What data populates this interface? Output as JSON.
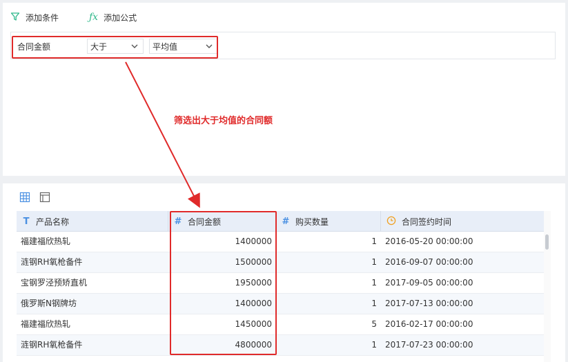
{
  "toolbar": {
    "add_condition": "添加条件",
    "add_formula": "添加公式"
  },
  "filter": {
    "field": "合同金额",
    "operator": "大于",
    "value": "平均值"
  },
  "annotation": "筛选出大于均值的合同额",
  "table": {
    "columns": [
      {
        "icon": "text-type-icon",
        "glyph": "T",
        "label": "产品名称"
      },
      {
        "icon": "number-type-icon",
        "glyph": "#",
        "label": "合同金额"
      },
      {
        "icon": "number-type-icon",
        "glyph": "#",
        "label": "购买数量"
      },
      {
        "icon": "time-type-icon",
        "glyph": "",
        "label": "合同签约时间"
      }
    ],
    "rows": [
      {
        "name": "福建福欣热轧",
        "amount": "1400000",
        "qty": "1",
        "date": "2016-05-20 00:00:00"
      },
      {
        "name": "涟钢RH氧枪备件",
        "amount": "1500000",
        "qty": "1",
        "date": "2016-09-07 00:00:00"
      },
      {
        "name": "宝钢罗泾预矫直机",
        "amount": "1950000",
        "qty": "1",
        "date": "2017-09-05 00:00:00"
      },
      {
        "name": "俄罗斯N钢牌坊",
        "amount": "1400000",
        "qty": "1",
        "date": "2017-07-13 00:00:00"
      },
      {
        "name": "福建福欣热轧",
        "amount": "1450000",
        "qty": "5",
        "date": "2016-02-17 00:00:00"
      },
      {
        "name": "涟钢RH氧枪备件",
        "amount": "4800000",
        "qty": "1",
        "date": "2017-07-23 00:00:00"
      }
    ]
  },
  "colors": {
    "accent": "#e02a2a",
    "icon_blue": "#4a90e2",
    "time_orange": "#f0a020",
    "filter_green": "#2fb88b",
    "header_bg": "#e8eef8"
  }
}
